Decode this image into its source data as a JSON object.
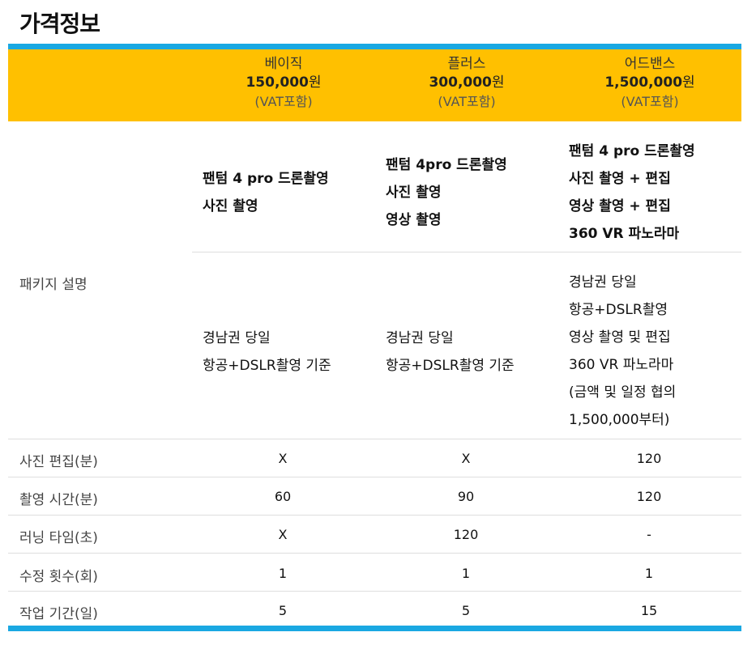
{
  "page_title": "가격정보",
  "plans": [
    {
      "name": "베이직",
      "price_num": "150,000",
      "price_unit": "원",
      "vat": "(VAT포함)"
    },
    {
      "name": "플러스",
      "price_num": "300,000",
      "price_unit": "원",
      "vat": "(VAT포함)"
    },
    {
      "name": "어드밴스",
      "price_num": "1,500,000",
      "price_unit": "원",
      "vat": "(VAT포함)"
    }
  ],
  "package": {
    "label": "패키지 설명",
    "features": [
      [
        "팬텀 4 pro 드론촬영",
        "사진 촬영"
      ],
      [
        "팬텀 4pro 드론촬영",
        "사진 촬영",
        "영상 촬영"
      ],
      [
        "팬텀 4 pro 드론촬영",
        "사진 촬영 +  편집",
        "영상 촬영 +  편집",
        "360 VR 파노라마"
      ]
    ],
    "descriptions": [
      [
        "경남권 당일",
        "항공+DSLR촬영 기준"
      ],
      [
        "경남권 당일",
        "항공+DSLR촬영 기준"
      ],
      [
        "경남권 당일",
        "항공+DSLR촬영",
        "영상 촬영 및 편집",
        "360 VR 파노라마",
        "(금액 및 일정 협의",
        "1,500,000부터)"
      ]
    ]
  },
  "rows": [
    {
      "label": "사진 편집(분)",
      "values": [
        "X",
        "X",
        "120"
      ]
    },
    {
      "label": "촬영 시간(분)",
      "values": [
        "60",
        "90",
        "120"
      ]
    },
    {
      "label": "러닝 타임(초)",
      "values": [
        "X",
        "120",
        "-"
      ]
    },
    {
      "label": "수정 횟수(회)",
      "values": [
        "1",
        "1",
        "1"
      ]
    },
    {
      "label": "작업 기간(일)",
      "values": [
        "5",
        "5",
        "15"
      ]
    }
  ],
  "colors": {
    "header_bg": "#ffc000",
    "accent_bar": "#1aa8e2"
  }
}
